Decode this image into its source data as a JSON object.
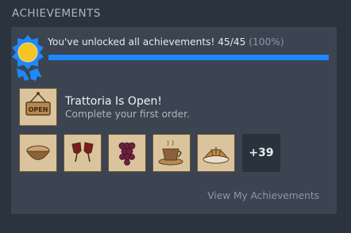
{
  "section": {
    "title": "ACHIEVEMENTS"
  },
  "summary": {
    "message": "You've unlocked all achievements!",
    "count": "45/45",
    "percent": "(100%)",
    "progress": 1.0
  },
  "featured": {
    "icon": "open-sign-icon",
    "title": "Trattoria Is Open!",
    "description": "Complete your first order."
  },
  "thumbnails": [
    {
      "icon": "bread-bowl-icon"
    },
    {
      "icon": "wine-glasses-icon"
    },
    {
      "icon": "grapes-icon"
    },
    {
      "icon": "coffee-cup-icon"
    },
    {
      "icon": "croissant-icon"
    }
  ],
  "more_count": "+39",
  "view_link": "View My Achievements",
  "colors": {
    "accent": "#1e88ff",
    "medal_gold": "#f5c425",
    "medal_blue": "#1e88ff"
  }
}
